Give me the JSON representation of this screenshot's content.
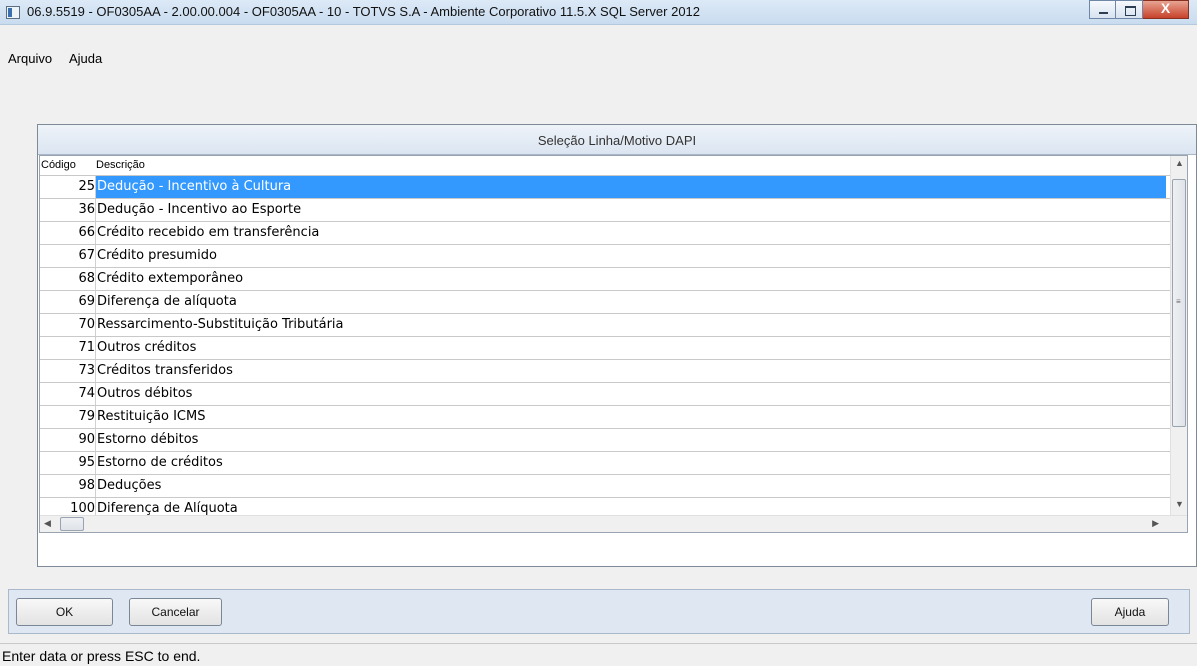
{
  "window": {
    "title": "06.9.5519 - OF0305AA - 2.00.00.004 - OF0305AA - 10 - TOTVS S.A - Ambiente Corporativo 11.5.X SQL Server 2012",
    "close_glyph": "X"
  },
  "menu": [
    "Arquivo",
    "Ajuda"
  ],
  "dialog": {
    "title": "Seleção Linha/Motivo DAPI",
    "columns": [
      "Código",
      "Descrição"
    ],
    "rows": [
      {
        "code": "25",
        "desc": "Dedução - Incentivo à Cultura"
      },
      {
        "code": "36",
        "desc": "Dedução - Incentivo ao Esporte"
      },
      {
        "code": "66",
        "desc": "Crédito recebido em transferência"
      },
      {
        "code": "67",
        "desc": "Crédito presumido"
      },
      {
        "code": "68",
        "desc": "Crédito extemporâneo"
      },
      {
        "code": "69",
        "desc": "Diferença de alíquota"
      },
      {
        "code": "70",
        "desc": "Ressarcimento-Substituição Tributária"
      },
      {
        "code": "71",
        "desc": "Outros créditos"
      },
      {
        "code": "73",
        "desc": "Créditos transferidos"
      },
      {
        "code": "74",
        "desc": "Outros débitos"
      },
      {
        "code": "79",
        "desc": "Restituição ICMS"
      },
      {
        "code": "90",
        "desc": "Estorno débitos"
      },
      {
        "code": "95",
        "desc": "Estorno de créditos"
      },
      {
        "code": "98",
        "desc": "Deduções"
      },
      {
        "code": "100",
        "desc": "Diferença de Alíquota"
      }
    ],
    "selected_code": "25"
  },
  "buttons": {
    "ok": "OK",
    "cancel": "Cancelar",
    "help": "Ajuda"
  },
  "status": "Enter data or press ESC to end.",
  "colors": {
    "selection": "#3399ff",
    "buttonbar": "#dfe8f2"
  }
}
